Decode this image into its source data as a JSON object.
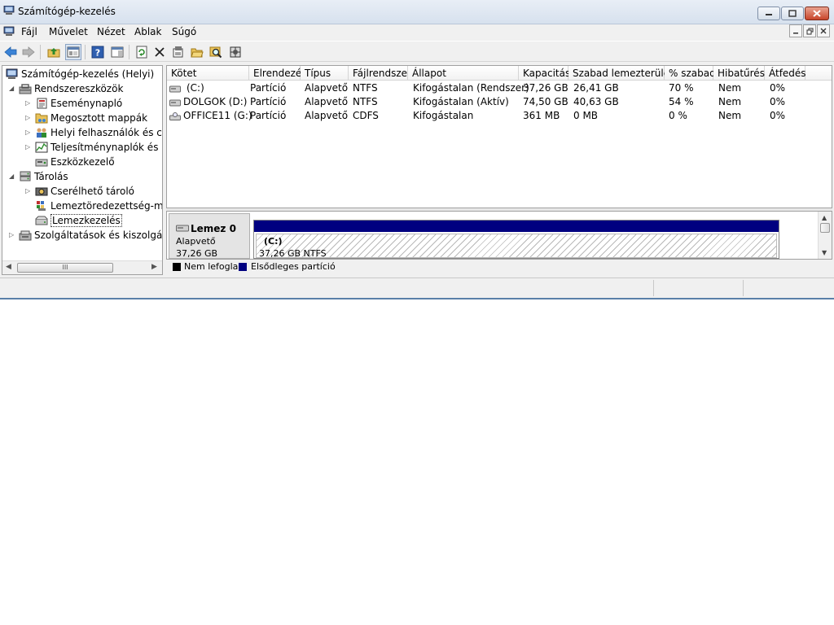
{
  "window": {
    "title": "Számítógép-kezelés"
  },
  "menu": {
    "items": [
      "Fájl",
      "Művelet",
      "Nézet",
      "Ablak",
      "Súgó"
    ]
  },
  "tree": {
    "root": "Számítógép-kezelés (Helyi)",
    "system_tools": "Rendszereszközök",
    "event_viewer": "Eseménynapló",
    "shared_folders": "Megosztott mappák",
    "local_users": "Helyi felhasználók és csop",
    "performance": "Teljesítménynaplók és ria",
    "device_manager": "Eszközkezelő",
    "storage": "Tárolás",
    "removable": "Cserélhető tároló",
    "defrag": "Lemeztöredezettség-men",
    "disk_mgmt": "Lemezkezelés",
    "services": "Szolgáltatások és kiszolgálói a"
  },
  "volumes": {
    "headers": [
      "Kötet",
      "Elrendezés",
      "Típus",
      "Fájlrendszer",
      "Állapot",
      "Kapacitás",
      "Szabad lemezterület",
      "% szabad",
      "Hibatűrés",
      "Átfedés"
    ],
    "rows": [
      [
        "(C:)",
        "Partíció",
        "Alapvető",
        "NTFS",
        "Kifogástalan (Rendszer)",
        "37,26 GB",
        "26,41 GB",
        "70 %",
        "Nem",
        "0%"
      ],
      [
        "DOLGOK (D:)",
        "Partíció",
        "Alapvető",
        "NTFS",
        "Kifogástalan (Aktív)",
        "74,50 GB",
        "40,63 GB",
        "54 %",
        "Nem",
        "0%"
      ],
      [
        "OFFICE11 (G:)",
        "Partíció",
        "Alapvető",
        "CDFS",
        "Kifogástalan",
        "361 MB",
        "0 MB",
        "0 %",
        "Nem",
        "0%"
      ]
    ]
  },
  "disk": {
    "name": "Lemez 0",
    "type": "Alapvető",
    "size": "37,26 GB",
    "partition_name": "(C:)",
    "partition_size": "37,26 GB NTFS"
  },
  "legend": {
    "unallocated": "Nem lefoglalt",
    "primary": "Elsődleges partíció",
    "unallocated_color": "#000000",
    "primary_color": "#000080"
  },
  "tree_scroll_label": "III"
}
